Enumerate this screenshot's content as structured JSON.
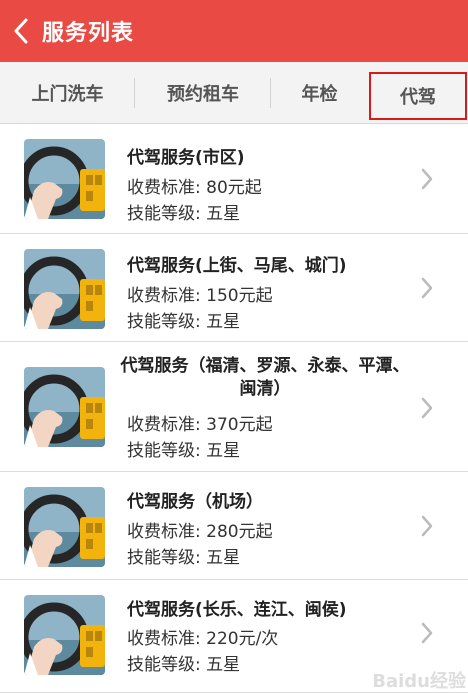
{
  "header": {
    "title": "服务列表",
    "back_icon": "back-arrow-icon"
  },
  "tabs": [
    {
      "label": "上门洗车",
      "active": false
    },
    {
      "label": "预约租车",
      "active": false
    },
    {
      "label": "年检",
      "active": false
    },
    {
      "label": "代驾",
      "active": true
    }
  ],
  "services": [
    {
      "title": "代驾服务(市区)",
      "price": "收费标准: 80元起",
      "level": "技能等级: 五星",
      "icon": "driver-steering-wheel-image"
    },
    {
      "title": "代驾服务(上街、马尾、城门)",
      "price": "收费标准: 150元起",
      "level": "技能等级: 五星",
      "icon": "driver-steering-wheel-image"
    },
    {
      "title": "代驾服务（福清、罗源、永泰、平潭、闽清）",
      "price": "收费标准: 370元起",
      "level": "技能等级: 五星",
      "icon": "driver-steering-wheel-image"
    },
    {
      "title": "代驾服务（机场）",
      "price": "收费标准: 280元起",
      "level": "技能等级: 五星",
      "icon": "driver-steering-wheel-image"
    },
    {
      "title": "代驾服务(长乐、连江、闽侯)",
      "price": "收费标准: 220元/次",
      "level": "技能等级: 五星",
      "icon": "driver-steering-wheel-image"
    }
  ],
  "watermark": {
    "text": "Baidu经验"
  },
  "colors": {
    "primary": "#e94a43",
    "active_outline": "#d81a1a",
    "tab_background": "#f3f3f3",
    "list_background": "#ffffff"
  }
}
